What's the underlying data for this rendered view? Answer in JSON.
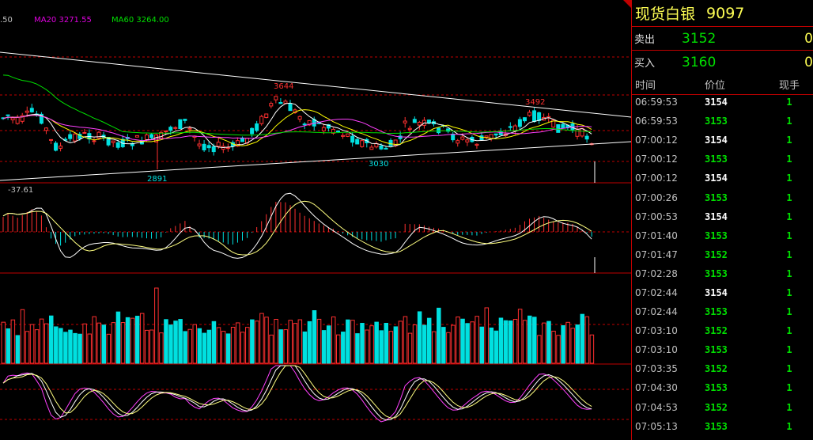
{
  "ma_legend": {
    "prev_label": ".50",
    "ma20": "MA20 3271.55",
    "ma60": "MA60 3264.00",
    "ma20_color": "#e000e0",
    "ma60_color": "#00e000"
  },
  "annotations": {
    "high_left": "3644",
    "high_right": "3492",
    "low_left": "2891",
    "low_mid": "3030",
    "macd_label": "-37.61"
  },
  "panel": {
    "name": "现货白银",
    "code": "9097",
    "sell_label": "卖出",
    "sell_price": "3152",
    "sell_vol": "0",
    "buy_label": "买入",
    "buy_price": "3160",
    "buy_vol": "0",
    "col_time": "时间",
    "col_price": "价位",
    "col_vol": "现手"
  },
  "ticks": [
    {
      "time": "06:59:53",
      "price": "3154",
      "vol": "1",
      "dir": "up"
    },
    {
      "time": "06:59:53",
      "price": "3153",
      "vol": "1",
      "dir": "dn"
    },
    {
      "time": "07:00:12",
      "price": "3154",
      "vol": "1",
      "dir": "up"
    },
    {
      "time": "07:00:12",
      "price": "3153",
      "vol": "1",
      "dir": "dn"
    },
    {
      "time": "07:00:12",
      "price": "3154",
      "vol": "1",
      "dir": "up"
    },
    {
      "time": "07:00:26",
      "price": "3153",
      "vol": "1",
      "dir": "dn"
    },
    {
      "time": "07:00:53",
      "price": "3154",
      "vol": "1",
      "dir": "up"
    },
    {
      "time": "07:01:40",
      "price": "3153",
      "vol": "1",
      "dir": "dn"
    },
    {
      "time": "07:01:47",
      "price": "3152",
      "vol": "1",
      "dir": "dn"
    },
    {
      "time": "07:02:28",
      "price": "3153",
      "vol": "1",
      "dir": "dn"
    },
    {
      "time": "07:02:44",
      "price": "3154",
      "vol": "1",
      "dir": "up"
    },
    {
      "time": "07:02:44",
      "price": "3153",
      "vol": "1",
      "dir": "dn"
    },
    {
      "time": "07:03:10",
      "price": "3152",
      "vol": "1",
      "dir": "dn"
    },
    {
      "time": "07:03:10",
      "price": "3153",
      "vol": "1",
      "dir": "dn"
    },
    {
      "time": "07:03:35",
      "price": "3152",
      "vol": "1",
      "dir": "dn"
    },
    {
      "time": "07:04:30",
      "price": "3153",
      "vol": "1",
      "dir": "dn"
    },
    {
      "time": "07:04:53",
      "price": "3152",
      "vol": "1",
      "dir": "dn"
    },
    {
      "time": "07:05:13",
      "price": "3153",
      "vol": "1",
      "dir": "dn"
    }
  ],
  "colors": {
    "up": "#ff3030",
    "down": "#00e0e0",
    "grid": "#c00000",
    "trend": "#ffffff",
    "macd_line": "#ffff80",
    "kdj_k": "#ff40ff"
  }
}
